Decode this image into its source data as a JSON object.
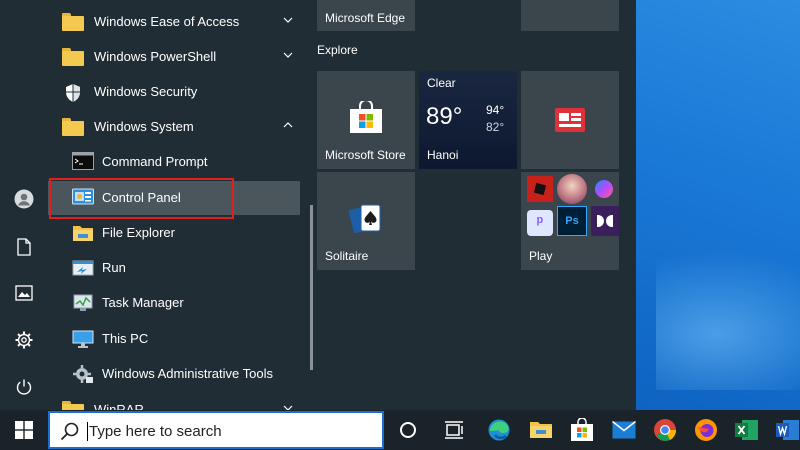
{
  "desktop": {
    "background": "#1a78d6"
  },
  "start_menu": {
    "apps": [
      {
        "label": "Windows Ease of Access",
        "expandable": true
      },
      {
        "label": "Windows PowerShell",
        "expandable": true
      },
      {
        "label": "Windows Security",
        "expandable": false
      },
      {
        "label": "Windows System",
        "expandable": true,
        "expanded": true
      },
      {
        "label": "Command Prompt"
      },
      {
        "label": "Control Panel",
        "selected": true
      },
      {
        "label": "File Explorer"
      },
      {
        "label": "Run"
      },
      {
        "label": "Task Manager"
      },
      {
        "label": "This PC"
      },
      {
        "label": "Windows Administrative Tools"
      },
      {
        "label": "WinRAR",
        "expandable": true
      }
    ],
    "rail_icons": [
      "user-icon",
      "document-icon",
      "pictures-icon",
      "settings-icon",
      "power-icon"
    ],
    "tiles": {
      "edge_label": "Microsoft Edge",
      "group_title": "Explore",
      "store_label": "Microsoft Store",
      "weather": {
        "condition": "Clear",
        "temp": "89°",
        "high": "94°",
        "low": "82°",
        "city": "Hanoi"
      },
      "solitaire_label": "Solitaire",
      "play_label": "Play"
    }
  },
  "taskbar": {
    "search_placeholder": "Type here to search",
    "icons": [
      "windows-start-icon",
      "cortana-icon",
      "task-view-icon",
      "edge-icon",
      "file-explorer-icon",
      "store-icon",
      "mail-icon",
      "chrome-icon",
      "firefox-icon",
      "excel-icon",
      "word-icon"
    ]
  },
  "colors": {
    "accent": "#1a6fd0",
    "highlight_box": "#e02020",
    "menu_bg": "#212d34",
    "tile_bg": "#3a454c"
  }
}
